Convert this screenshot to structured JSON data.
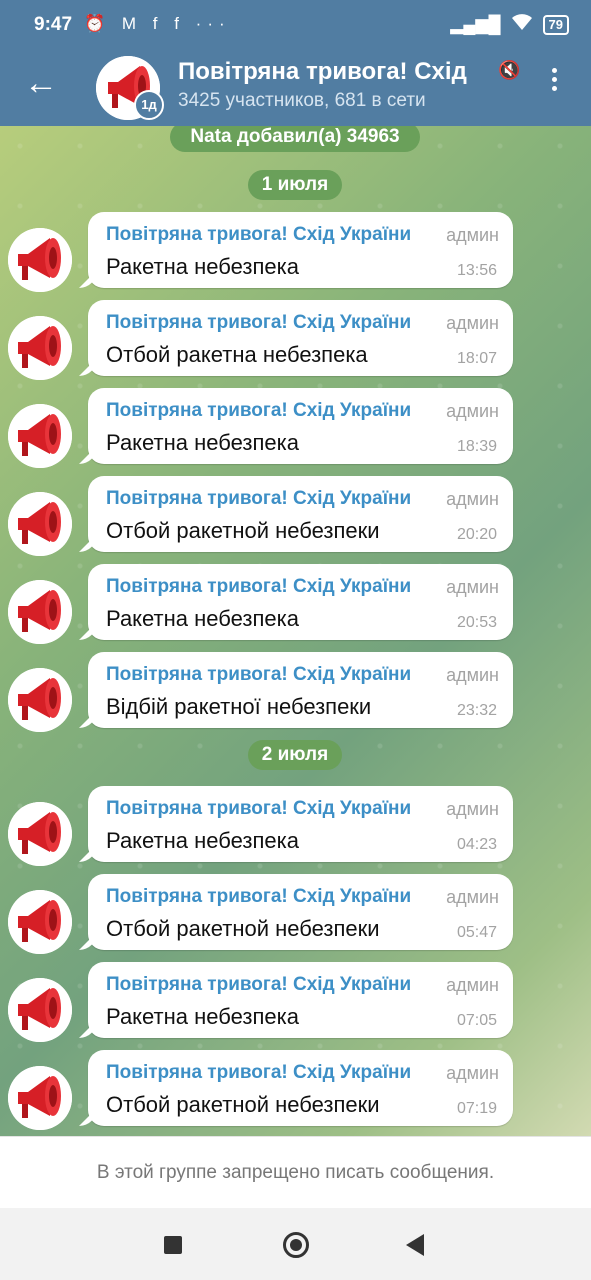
{
  "status_bar": {
    "time": "9:47",
    "left_icons": "⏰ M f f ···",
    "signal": "▂▄▆█",
    "wifi": "wifi-icon",
    "battery": "79"
  },
  "header": {
    "title": "Повітряна тривога! Схід",
    "subtitle": "3425 участников, 681 в сети",
    "badge": "1д",
    "mute_icon": "🔇"
  },
  "chat": {
    "system_message": "Nata добавил(а) 34963",
    "date_1": "1 июля",
    "date_2": "2 июля",
    "messages": [
      {
        "sender": "Повітряна тривога! Схід України",
        "role": "админ",
        "text": "Ракетна небезпека",
        "time": "13:56"
      },
      {
        "sender": "Повітряна тривога! Схід України",
        "role": "админ",
        "text": "Отбой ракетна небезпека",
        "time": "18:07"
      },
      {
        "sender": "Повітряна тривога! Схід України",
        "role": "админ",
        "text": "Ракетна небезпека",
        "time": "18:39"
      },
      {
        "sender": "Повітряна тривога! Схід України",
        "role": "админ",
        "text": "Отбой ракетной небезпеки",
        "time": "20:20"
      },
      {
        "sender": "Повітряна тривога! Схід України",
        "role": "админ",
        "text": "Ракетна небезпека",
        "time": "20:53"
      },
      {
        "sender": "Повітряна тривога! Схід України",
        "role": "админ",
        "text": "Відбій ракетної небезпеки",
        "time": "23:32"
      },
      {
        "sender": "Повітряна тривога! Схід України",
        "role": "админ",
        "text": "Ракетна небезпека",
        "time": "04:23"
      },
      {
        "sender": "Повітряна тривога! Схід України",
        "role": "админ",
        "text": "Отбой ракетной небезпеки",
        "time": "05:47"
      },
      {
        "sender": "Повітряна тривога! Схід України",
        "role": "админ",
        "text": "Ракетна небезпека",
        "time": "07:05"
      },
      {
        "sender": "Повітряна тривога! Схід України",
        "role": "админ",
        "text": "Отбой ракетной небезпеки",
        "time": "07:19"
      }
    ]
  },
  "footer": {
    "notice": "В этой группе запрещено писать сообщения."
  },
  "colors": {
    "header_bg": "#517da2",
    "sender_name": "#3d8fc6",
    "date_pill": "#6aa05a",
    "siren_red": "#d61f26"
  }
}
